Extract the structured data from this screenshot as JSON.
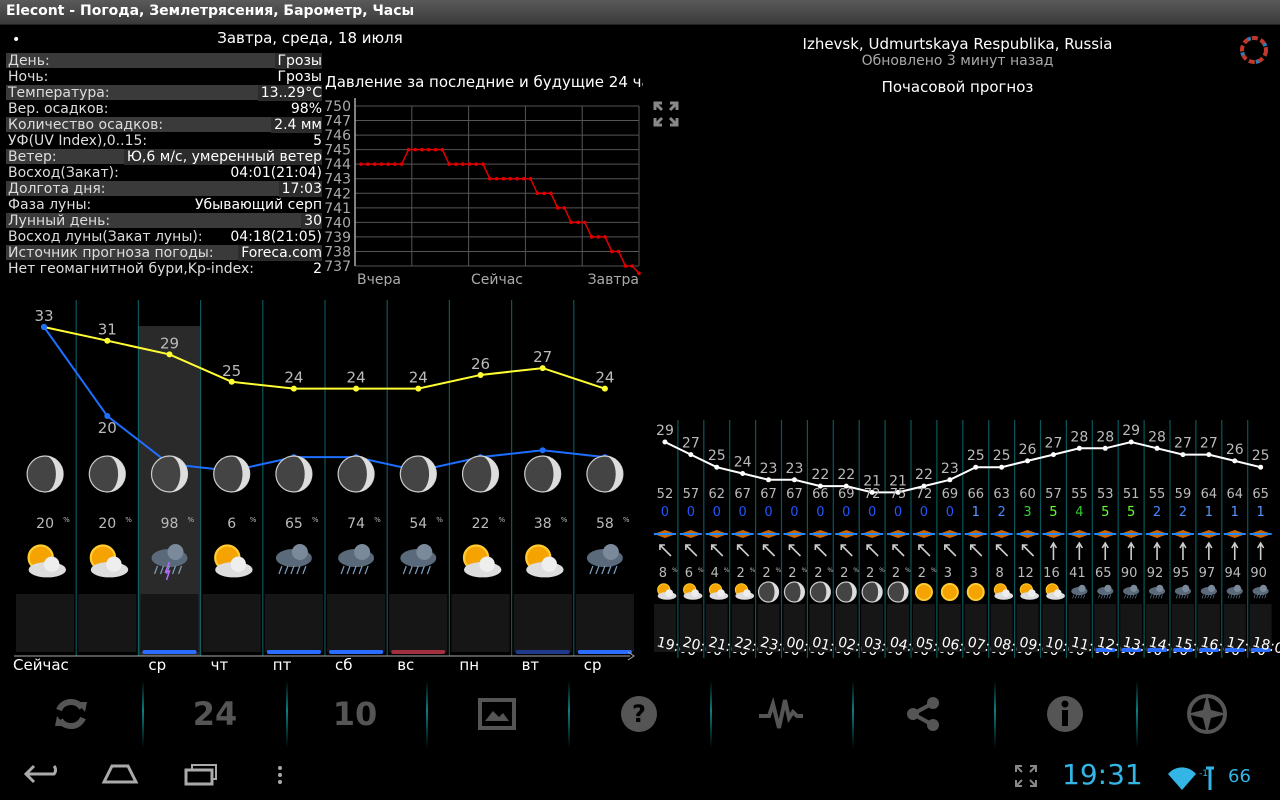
{
  "window": {
    "title": "Elecont - Погода, Землетрясения, Барометр, Часы"
  },
  "detail": {
    "indicator": "•",
    "title": "Завтра, среда, 18 июля",
    "rows": [
      {
        "label": "День:",
        "value": "Грозы"
      },
      {
        "label": "Ночь:",
        "value": "Грозы"
      },
      {
        "label": "Температура:",
        "value": "13..29°C"
      },
      {
        "label": "Вер. осадков:",
        "value": "98%"
      },
      {
        "label": "Количество осадков:",
        "value": "2.4 мм"
      },
      {
        "label": "УФ(UV Index),0..15:",
        "value": "5"
      },
      {
        "label": "Ветер:",
        "value": "Ю,6 м/с, умеренный ветер"
      },
      {
        "label": "Восход(Закат):",
        "value": "04:01(21:04)"
      },
      {
        "label": "Долгота дня:",
        "value": "17:03"
      },
      {
        "label": "Фаза луны:",
        "value": "Убывающий серп"
      },
      {
        "label": "Лунный день:",
        "value": "30"
      },
      {
        "label": "Восход луны(Закат луны):",
        "value": "04:18(21:05)"
      },
      {
        "label": "Источник прогноза погоды:",
        "value": "Foreca.com"
      },
      {
        "label": "Нет геомагнитной бури,Kp-index:",
        "value": "2"
      }
    ]
  },
  "header": {
    "location": "Izhevsk, Udmurtskaya Respublika, Russia",
    "updated": "Обновлено 3 минут назад",
    "hourly_title": "Почасовой прогноз"
  },
  "colors": {
    "accent": "#33b5e5",
    "teal": "#0d7d80",
    "high": "#ffff33",
    "low": "#1e6fff",
    "pressure": "#e00000"
  },
  "chart_data": [
    {
      "type": "line",
      "title": "Давление за последние и будущие 24 ча..",
      "y_ticks": [
        "750",
        "747",
        "746",
        "745",
        "744",
        "743",
        "742",
        "741",
        "740",
        "739",
        "738",
        "737"
      ],
      "x_labels": [
        "Вчера",
        "Сейчас",
        "Завтра"
      ],
      "ylim": [
        737,
        750
      ],
      "series": [
        {
          "values": [
            744,
            744,
            744,
            744,
            744,
            744,
            744,
            745,
            745,
            745,
            745,
            745,
            745,
            744,
            744,
            744,
            744,
            744,
            744,
            743,
            743,
            743,
            743,
            743,
            743,
            743,
            742,
            742,
            742,
            741,
            741,
            740,
            740,
            740,
            739,
            739,
            739,
            738,
            738,
            737,
            737,
            736.5
          ]
        }
      ]
    },
    {
      "type": "line",
      "categories": [
        "Сейчас",
        "",
        "ср",
        "чт",
        "пт",
        "сб",
        "вс",
        "пн",
        "вт",
        "ср"
      ],
      "series": [
        {
          "values": [
            33,
            31,
            29,
            25,
            24,
            24,
            24,
            26,
            27,
            24
          ]
        },
        {
          "values": [
            33,
            20,
            13,
            12,
            14,
            14,
            12,
            14,
            15,
            14
          ]
        }
      ],
      "precip_prob": [
        "20",
        "20",
        "98",
        "6",
        "65",
        "74",
        "54",
        "22",
        "38",
        "58"
      ],
      "precip_unit": "%",
      "weather_icons": [
        "sun-cloud",
        "sun-cloud",
        "thunderstorm",
        "sun-cloud",
        "storm",
        "storm",
        "storm",
        "sun-cloud",
        "sun-cloud",
        "storm"
      ]
    },
    {
      "type": "line",
      "categories": [
        "19:00",
        "20:00",
        "21:00",
        "22:00",
        "23:00",
        "00:00",
        "01:00",
        "02:00",
        "03:00",
        "04:00",
        "05:00",
        "06:00",
        "07:00",
        "08:00",
        "09:00",
        "10:00",
        "11:00",
        "12:00",
        "13:00",
        "14:00",
        "15:00",
        "16:00",
        "17:00",
        "18:00"
      ],
      "series": [
        {
          "values": [
            29,
            27,
            25,
            24,
            23,
            23,
            22,
            22,
            21,
            21,
            22,
            23,
            25,
            25,
            26,
            27,
            28,
            28,
            29,
            28,
            27,
            27,
            26,
            25
          ]
        }
      ],
      "humidity": [
        "52",
        "57",
        "62",
        "67",
        "67",
        "67",
        "66",
        "69",
        "72",
        "75",
        "72",
        "69",
        "66",
        "63",
        "60",
        "57",
        "55",
        "53",
        "51",
        "55",
        "59",
        "64",
        "64",
        "65"
      ],
      "uv": [
        "0",
        "0",
        "0",
        "0",
        "0",
        "0",
        "0",
        "0",
        "0",
        "0",
        "0",
        "0",
        "1",
        "2",
        "3",
        "5",
        "4",
        "5",
        "5",
        "2",
        "2",
        "1",
        "1",
        "1"
      ],
      "precip_prob": [
        "8",
        "6",
        "4",
        "2",
        "2",
        "2",
        "2",
        "2",
        "2",
        "2",
        "2",
        "3",
        "3",
        "8",
        "12",
        "16",
        "41",
        "65",
        "90",
        "92",
        "95",
        "97",
        "94",
        "90"
      ],
      "wind_direction_icons": [
        "nw",
        "nw",
        "nw",
        "nw",
        "nw",
        "nw",
        "nw",
        "nw",
        "nw",
        "nw",
        "nw",
        "nw",
        "nw",
        "nw",
        "nw",
        "n",
        "n",
        "n",
        "n",
        "n",
        "n",
        "n",
        "n",
        "n"
      ]
    }
  ],
  "toolbar": {
    "btn24": "24",
    "btn10": "10"
  },
  "status": {
    "time": "19:31",
    "battery": "66"
  }
}
